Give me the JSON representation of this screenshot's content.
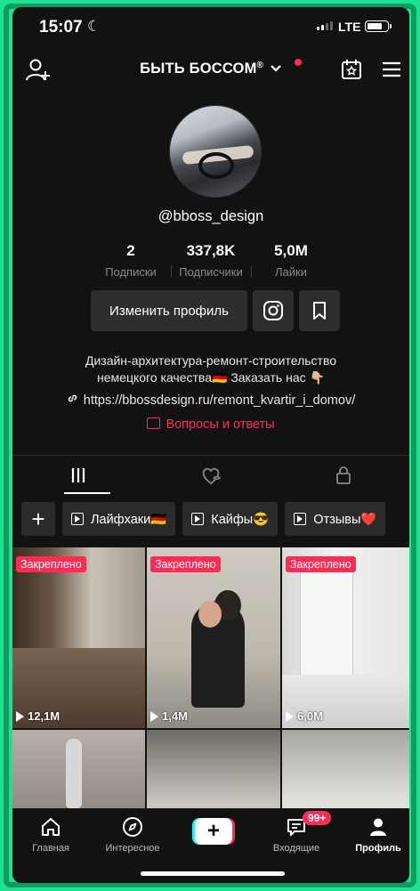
{
  "status_bar": {
    "time": "15:07",
    "network": "LTE"
  },
  "header": {
    "title": "БЫТЬ БОССОМ",
    "title_mark": "®"
  },
  "profile": {
    "username": "@bboss_design",
    "stats": [
      {
        "value": "2",
        "label": "Подписки"
      },
      {
        "value": "337,8K",
        "label": "Подписчики"
      },
      {
        "value": "5,0M",
        "label": "Лайки"
      }
    ],
    "edit_button": "Изменить профиль",
    "bio_line1": "Дизайн-архитектура-ремонт-строительство",
    "bio_line2": "немецкого качества🇩🇪 Заказать нас 👇🏼",
    "link": "https://bbossdesign.ru/remont_kvartir_i_domov/",
    "qa": "Вопросы и ответы"
  },
  "playlists": [
    {
      "label": "Лайфхаки🇩🇪"
    },
    {
      "label": "Кайфы😎"
    },
    {
      "label": "Отзывы❤️"
    }
  ],
  "videos": [
    {
      "pinned": "Закреплено",
      "views": "12,1M"
    },
    {
      "pinned": "Закреплено",
      "views": "1,4M"
    },
    {
      "pinned": "Закреплено",
      "views": "6,0M"
    }
  ],
  "bottom_nav": {
    "home": "Главная",
    "discover": "Интересное",
    "create": "+",
    "inbox": "Входящие",
    "inbox_badge": "99+",
    "profile": "Профиль"
  },
  "colors": {
    "accent": "#fe2c55",
    "cyan": "#25f4ee",
    "frame": "#19e38f",
    "background": "#121212"
  }
}
